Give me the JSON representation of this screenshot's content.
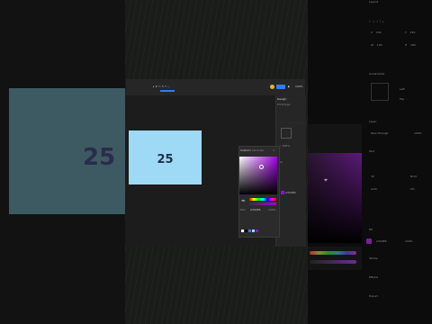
{
  "left": {
    "number": "25"
  },
  "frame": {
    "number": "25"
  },
  "props": {
    "design_tab": "Design",
    "prototype_tab": "Prototype",
    "fill_value": "A300E6",
    "opacity": "100%"
  },
  "picker": {
    "custom_label": "Custom",
    "libraries_label": "Libraries",
    "hex": "A300E6",
    "alpha": "100%"
  },
  "right": {
    "layout_label": "Layout",
    "constraints_label": "Constraints",
    "layer_label": "Layer",
    "pass_through": "Pass through",
    "text_label": "Text",
    "fill_label": "Fill",
    "fill_hex": "A300E6",
    "fill_opacity": "100%",
    "stroke_label": "Stroke",
    "effects_label": "Effects",
    "export_label": "Export"
  },
  "colors": {
    "accent": "#2f7df0",
    "fill": "#a300e6",
    "frame": "#9ed9f6"
  }
}
